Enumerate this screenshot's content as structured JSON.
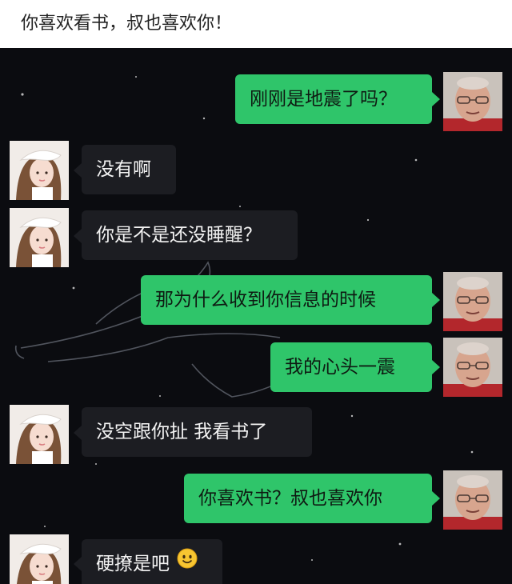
{
  "caption": "你喜欢看书，叔也喜欢你！",
  "messages": [
    {
      "side": "right",
      "text": "刚刚是地震了吗？"
    },
    {
      "side": "left",
      "text": "没有啊"
    },
    {
      "side": "left",
      "text": "你是不是还没睡醒？"
    },
    {
      "side": "right",
      "text": "那为什么收到你信息的时候"
    },
    {
      "side": "right",
      "text": "我的心头一震"
    },
    {
      "side": "left",
      "text": "没空跟你扯 我看书了"
    },
    {
      "side": "right",
      "text": "你喜欢书？叔也喜欢你"
    },
    {
      "side": "left",
      "text": "硬撩是吧",
      "emoji": "smiling-face-emoji"
    }
  ],
  "colors": {
    "right_bubble": "#2fc56a",
    "left_bubble": "#1c1d22",
    "background": "#0b0c10"
  },
  "icons": {
    "right_avatar": "old-man-avatar",
    "left_avatar": "girl-avatar"
  }
}
